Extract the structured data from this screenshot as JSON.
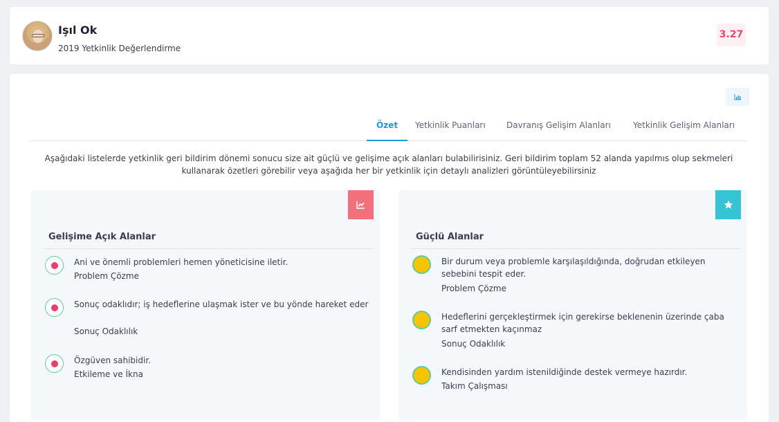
{
  "profile": {
    "name": "Işıl Ok",
    "subtitle": "2019 Yetkinlik Değerlendirme",
    "score": "3.27"
  },
  "tabs": [
    {
      "label": "Özet",
      "active": true
    },
    {
      "label": "Yetkinlik Puanları",
      "active": false
    },
    {
      "label": "Davranış Gelişim Alanları",
      "active": false
    },
    {
      "label": "Yetkinlik Gelişim Alanları",
      "active": false
    }
  ],
  "intro_text": "Aşağıdaki listelerde yetkinlik geri bildirim dönemi sonucu size ait güçlü ve gelişime açık alanları bulabilirisiniz. Geri bildirim toplam 52 alanda yapılmıs olup sekmeleri kullanarak özetleri görebilir veya aşağıda her bir yetkinlik için detaylı analizleri görüntüleyebilirsiniz",
  "development": {
    "title": "Gelişime Açık Alanlar",
    "icon": "chart-line-icon",
    "color": "#f1707b",
    "items": [
      {
        "text": "Ani ve önemli problemleri hemen yöneticisine iletir.",
        "category": "Problem Çözme"
      },
      {
        "text": "Sonuç odaklıdır; iş hedeflerine ulaşmak ister ve bu yönde hareket eder",
        "category": "Sonuç Odaklılık"
      },
      {
        "text": "Özgüven sahibidir.",
        "category": "Etkileme ve İkna"
      }
    ]
  },
  "strengths": {
    "title": "Güçlü Alanlar",
    "icon": "star-icon",
    "color": "#35c3d6",
    "items": [
      {
        "text": "Bir durum veya problemle karşılaşıldığında, doğrudan etkileyen sebebini tespit eder.",
        "category": "Problem Çözme"
      },
      {
        "text": "Hedeflerini gerçekleştirmek için gerekirse beklenenin üzerinde çaba sarf etmekten kaçınmaz",
        "category": "Sonuç Odaklılık"
      },
      {
        "text": "Kendisinden yardım istenildiğinde destek vermeye hazırdır.",
        "category": "Takım Çalışması"
      }
    ]
  }
}
